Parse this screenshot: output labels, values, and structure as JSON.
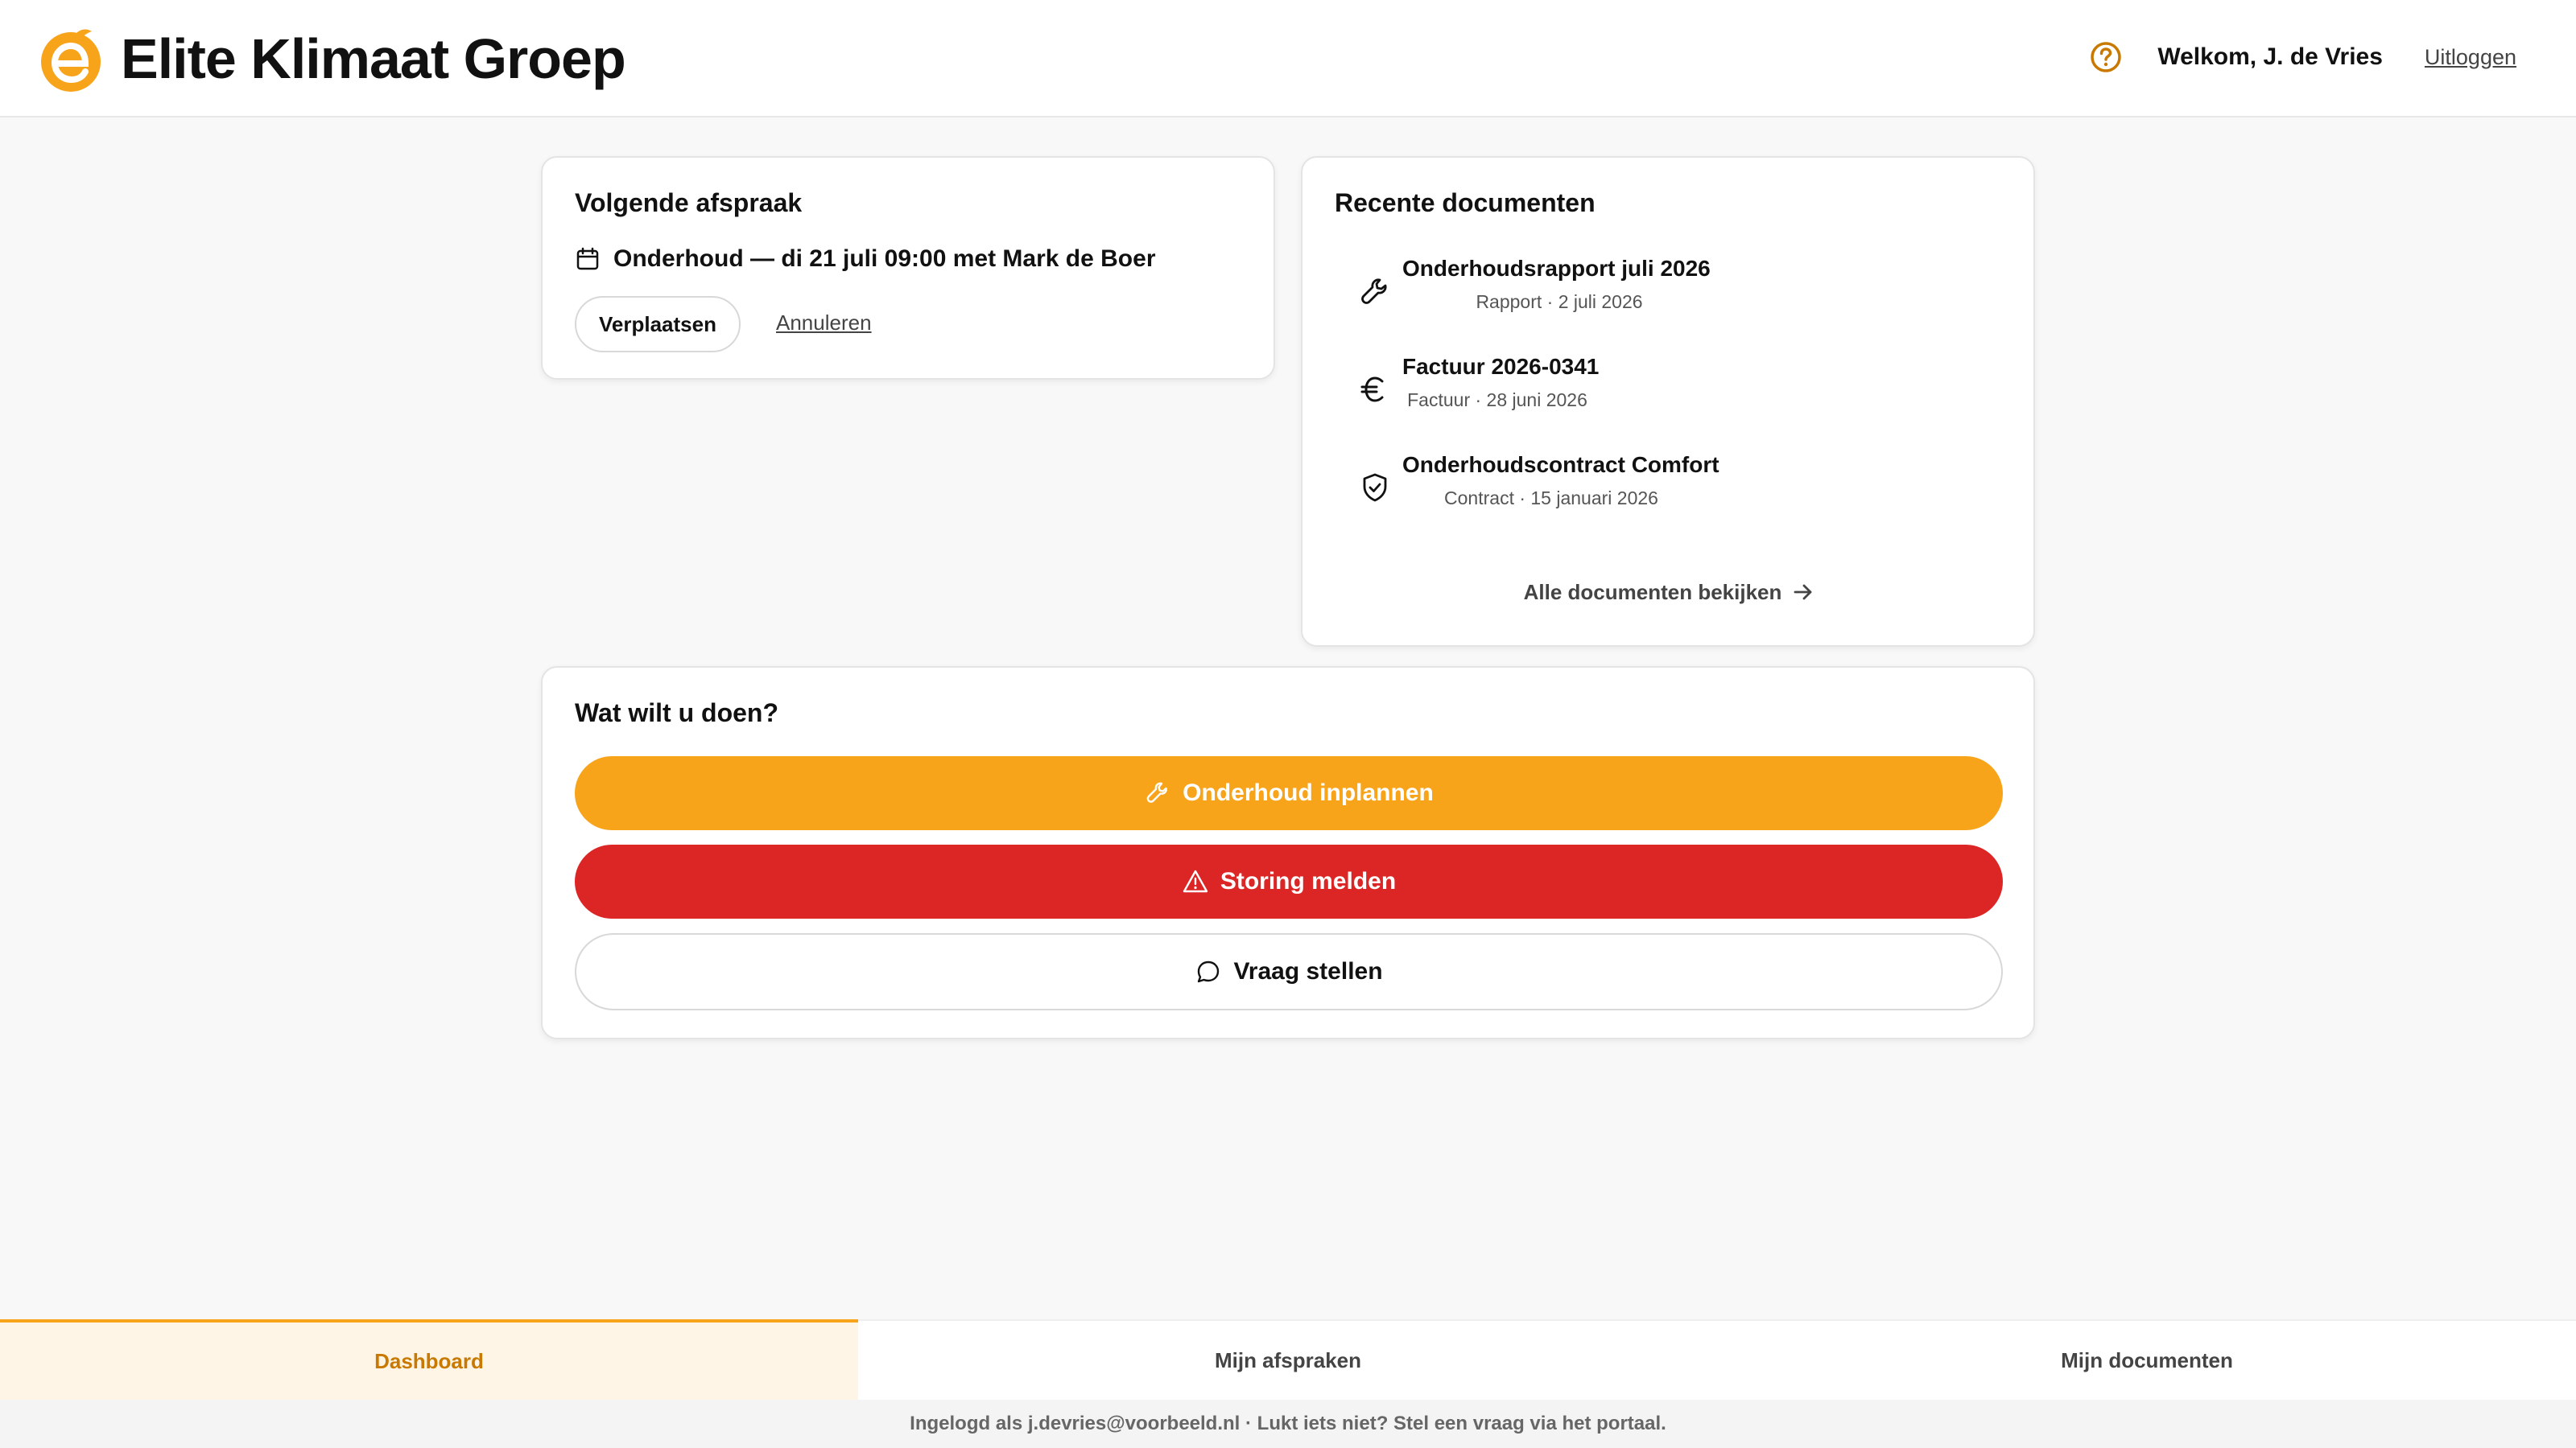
{
  "header": {
    "brand": "Elite Klimaat Groep",
    "welcome": "Welkom, J. de Vries",
    "logout": "Uitloggen",
    "help_icon": "help-circle-icon"
  },
  "appointment": {
    "title": "Volgende afspraak",
    "detail": "Onderhoud — di 21 juli 09:00 met Mark de Boer",
    "reschedule_label": "Verplaatsen",
    "cancel_label": "Annuleren"
  },
  "documents": {
    "title": "Recente documenten",
    "items": [
      {
        "title": "Onderhoudsrapport juli 2026",
        "meta": "Rapport · 2 juli 2026",
        "icon": "wrench-icon"
      },
      {
        "title": "Factuur 2026-0341",
        "meta": "Factuur · 28 juni 2026",
        "icon": "euro-icon"
      },
      {
        "title": "Onderhoudscontract Comfort",
        "meta": "Contract · 15 januari 2026",
        "icon": "shield-check-icon"
      }
    ],
    "all_label": "Alle documenten bekijken"
  },
  "actions": {
    "title": "Wat wilt u doen?",
    "schedule_label": "Onderhoud inplannen",
    "report_label": "Storing melden",
    "question_label": "Vraag stellen"
  },
  "nav": {
    "dashboard": "Dashboard",
    "appointments": "Mijn afspraken",
    "documents": "Mijn documenten"
  },
  "footer": {
    "text": "Ingelogd als j.devries@voorbeeld.nl · Lukt iets niet? Stel een vraag via het portaal."
  },
  "colors": {
    "accent": "#f8a41b",
    "danger": "#dc2626",
    "active_nav_text": "#c97800"
  }
}
